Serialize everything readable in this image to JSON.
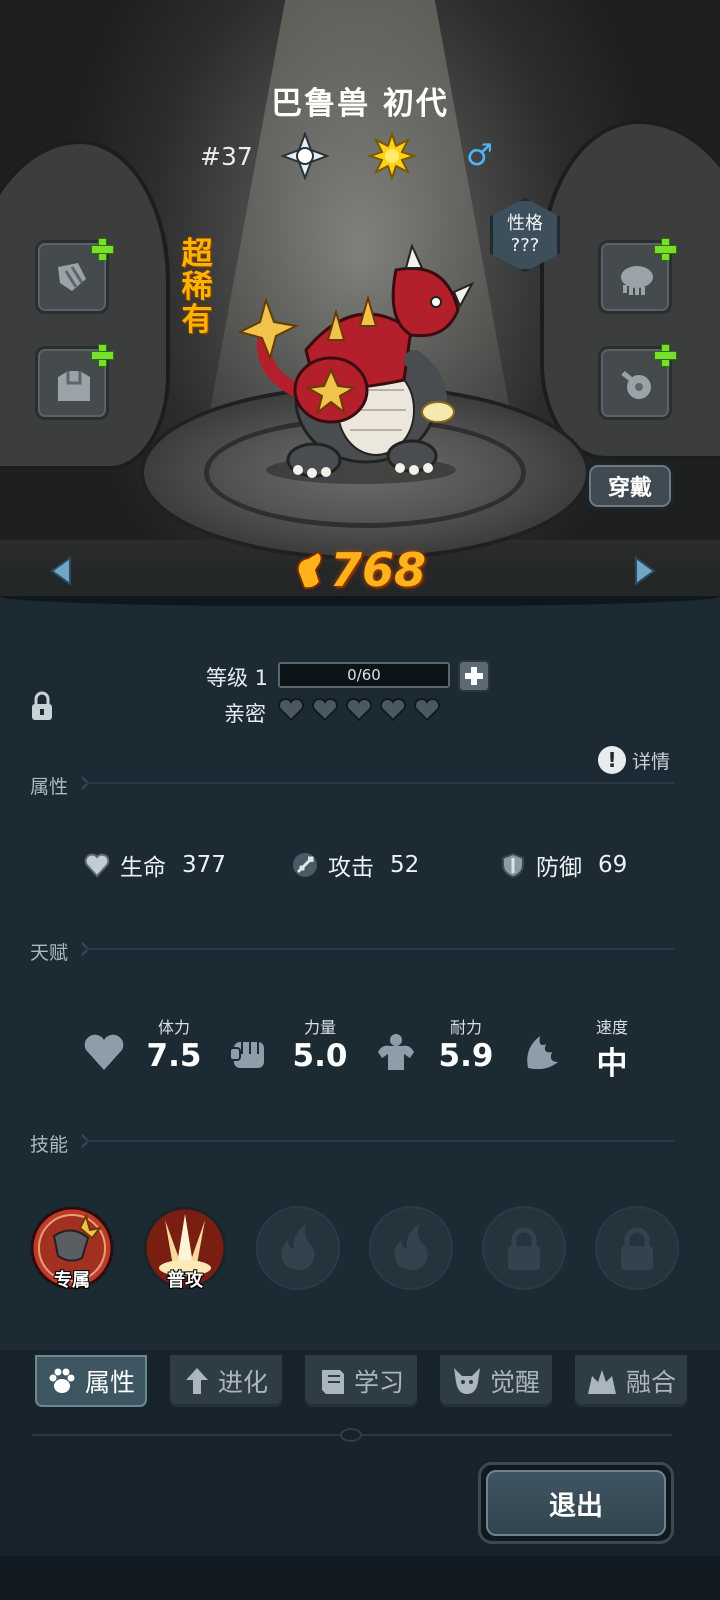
{
  "pet": {
    "name": "巴鲁兽 初代",
    "dex_no": "#37",
    "rarity": "超稀有",
    "personality_label": "性格",
    "personality_value": "???",
    "gender_symbol": "♂",
    "power_value": "768"
  },
  "actions": {
    "wear_label": "穿戴",
    "exit_label": "退出"
  },
  "level": {
    "label": "等级 1",
    "xp_text": "0/60",
    "xp_fraction": 0
  },
  "bond": {
    "label": "亲密",
    "hearts_filled": 0,
    "hearts_total": 5
  },
  "sections": {
    "attributes": "属性",
    "talents": "天赋",
    "skills": "技能",
    "detail_label": "详情"
  },
  "stats": [
    {
      "icon": "heart-shield-icon",
      "label": "生命",
      "value": "377"
    },
    {
      "icon": "sword-icon",
      "label": "攻击",
      "value": "52"
    },
    {
      "icon": "shield-icon",
      "label": "防御",
      "value": "69"
    }
  ],
  "talents": [
    {
      "icon": "heart-icon",
      "label": "体力",
      "value": "7.5"
    },
    {
      "icon": "fist-icon",
      "label": "力量",
      "value": "5.0"
    },
    {
      "icon": "muscle-icon",
      "label": "耐力",
      "value": "5.9"
    },
    {
      "icon": "wing-icon",
      "label": "速度",
      "value": "中"
    }
  ],
  "skills": [
    {
      "icon": "exclusive-skill-icon",
      "label": "专属",
      "state": "equipped"
    },
    {
      "icon": "basic-attack-icon",
      "label": "普攻",
      "state": "equipped"
    },
    {
      "icon": "flame-icon",
      "label": "",
      "state": "empty"
    },
    {
      "icon": "flame-icon",
      "label": "",
      "state": "empty"
    },
    {
      "icon": "lock-icon",
      "label": "",
      "state": "locked"
    },
    {
      "icon": "lock-icon",
      "label": "",
      "state": "locked"
    }
  ],
  "tabs": [
    {
      "icon": "paw-icon",
      "label": "属性",
      "active": true
    },
    {
      "icon": "evolve-arrow-icon",
      "label": "进化",
      "active": false
    },
    {
      "icon": "book-icon",
      "label": "学习",
      "active": false
    },
    {
      "icon": "demon-icon",
      "label": "觉醒",
      "active": false
    },
    {
      "icon": "fusion-icon",
      "label": "融合",
      "active": false
    }
  ],
  "colors": {
    "rarity": "#ffb300",
    "power": "#ffb21a",
    "gender": "#4fb4ff",
    "plus": "#76e02a",
    "panel_bg": "#1b2a33"
  }
}
